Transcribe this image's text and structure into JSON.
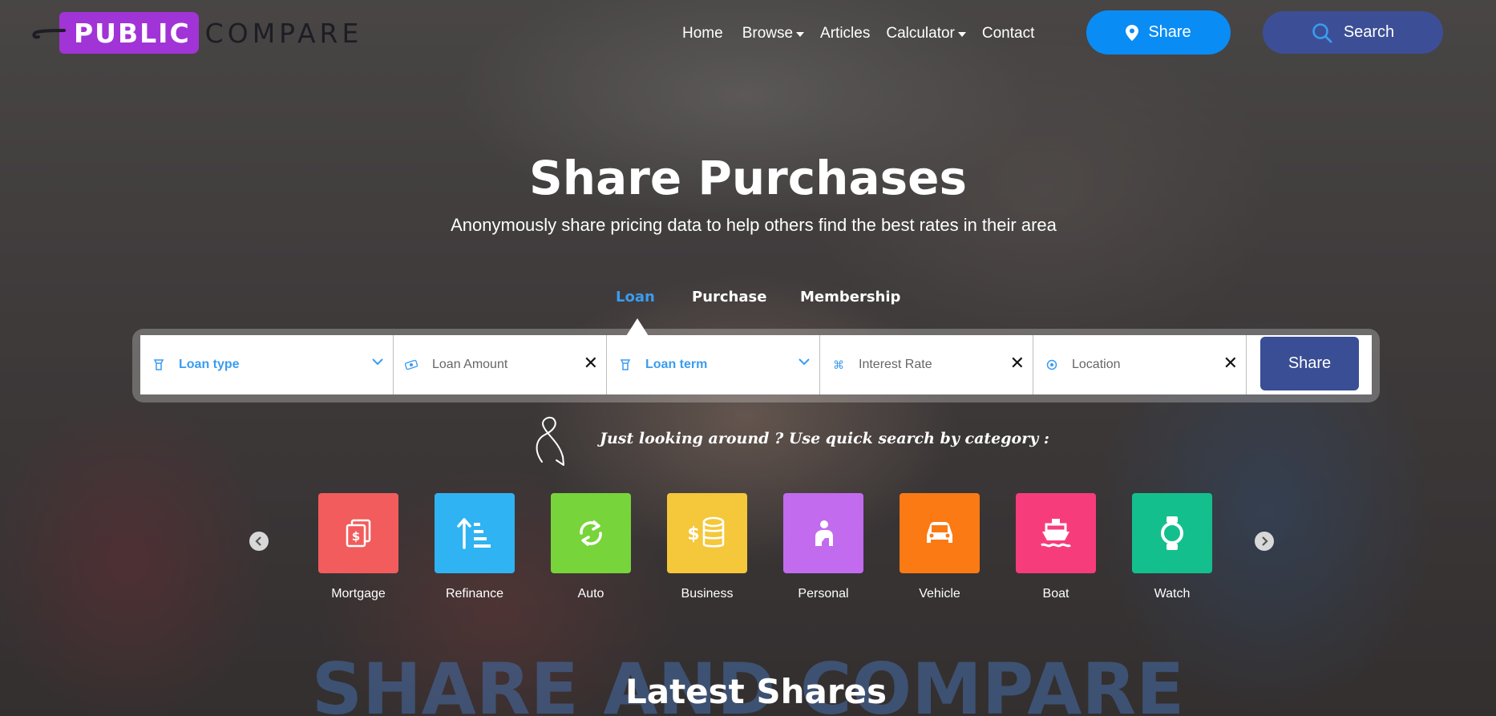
{
  "brand": {
    "part1": "PUBLIC",
    "part2": "COMPARE",
    "accent": "#a134d6"
  },
  "nav": {
    "home": "Home",
    "browse": "Browse",
    "articles": "Articles",
    "calculator": "Calculator",
    "contact": "Contact"
  },
  "header_buttons": {
    "share": "Share",
    "search": "Search"
  },
  "hero": {
    "title": "Share Purchases",
    "subtitle": "Anonymously share pricing data to help others find the best rates in their area"
  },
  "tabs": {
    "loan": "Loan",
    "purchase": "Purchase",
    "membership": "Membership",
    "active": "Loan"
  },
  "form": {
    "loan_type": "Loan type",
    "loan_amount": "Loan Amount",
    "loan_term": "Loan term",
    "interest_rate": "Interest Rate",
    "location": "Location",
    "submit": "Share"
  },
  "quick_search": {
    "text": "Just looking around ? Use quick search by category :"
  },
  "categories": [
    {
      "name": "Mortgage",
      "color": "#f25c5c",
      "icon": "mortgage-icon"
    },
    {
      "name": "Refinance",
      "color": "#2fb3f2",
      "icon": "refinance-icon"
    },
    {
      "name": "Auto",
      "color": "#77d43a",
      "icon": "auto-icon"
    },
    {
      "name": "Business",
      "color": "#f5c73a",
      "icon": "business-icon"
    },
    {
      "name": "Personal",
      "color": "#c26bef",
      "icon": "personal-icon"
    },
    {
      "name": "Vehicle",
      "color": "#fb7a14",
      "icon": "vehicle-icon"
    },
    {
      "name": "Boat",
      "color": "#f73c7c",
      "icon": "boat-icon"
    },
    {
      "name": "Watch",
      "color": "#14bf8e",
      "icon": "watch-icon"
    }
  ],
  "section": {
    "watermark": "SHARE AND COMPARE",
    "title": "Latest Shares"
  }
}
